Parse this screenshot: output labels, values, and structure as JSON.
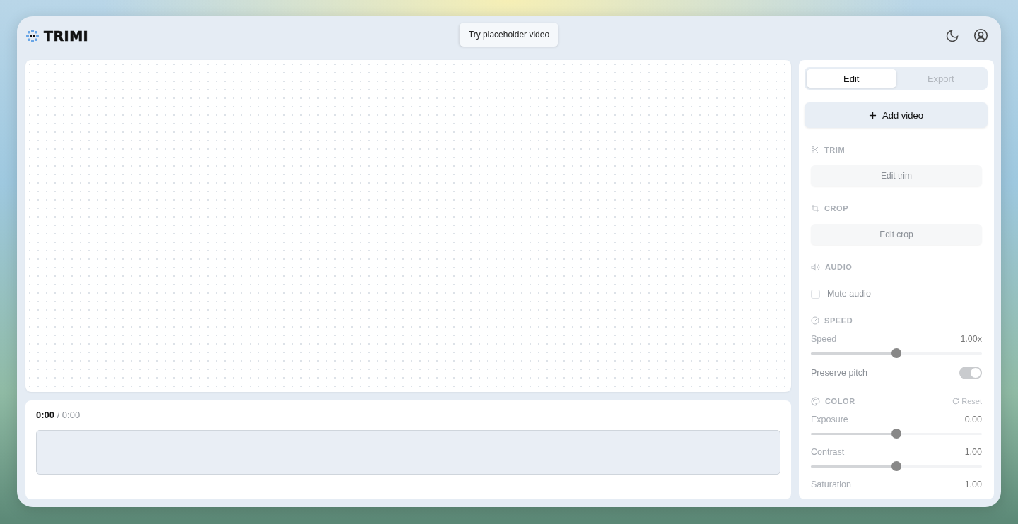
{
  "header": {
    "logo": "TRIMI",
    "placeholder_button": "Try placeholder video"
  },
  "timeline": {
    "time": "**0:00** / 0:00"
  },
  "panel": {
    "tabs": [
      {
        "label": "Edit",
        "selected": true
      },
      {
        "label": "Export",
        "selected": false
      }
    ],
    "add_button": "Add video",
    "sections": [
      {
        "kind": "trim",
        "title": "TRIM",
        "rows": [
          {
            "kind": "button",
            "label": "Edit trim"
          }
        ]
      },
      {
        "kind": "crop",
        "title": "CROP",
        "rows": [
          {
            "kind": "button",
            "label": "Edit crop"
          }
        ]
      },
      {
        "kind": "audio",
        "title": "AUDIO",
        "rows": [
          {
            "kind": "checkbox",
            "label": "Mute audio",
            "checked": false
          }
        ]
      },
      {
        "kind": "speed",
        "title": "SPEED",
        "rows": [
          {
            "kind": "slider",
            "label": "Speed",
            "value": "1.00x",
            "level": 0.5
          },
          {
            "kind": "toggle",
            "label": "Preserve pitch",
            "on": true
          }
        ]
      },
      {
        "kind": "color",
        "title": "COLOR",
        "action": "Reset",
        "rows": [
          {
            "kind": "slider",
            "label": "Exposure",
            "value": "0.00",
            "level": 0.5
          },
          {
            "kind": "slider",
            "label": "Contrast",
            "value": "1.00",
            "level": 0.5
          },
          {
            "kind": "slider",
            "label": "Saturation",
            "value": "1.00"
          }
        ]
      }
    ]
  }
}
